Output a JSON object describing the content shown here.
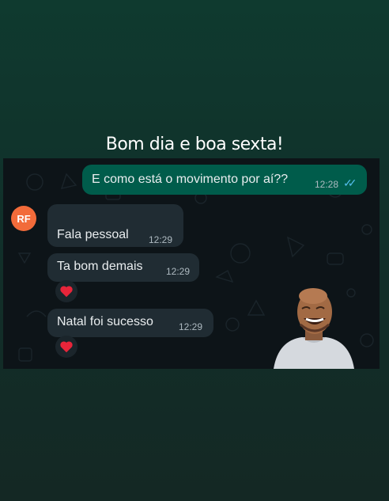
{
  "caption": "Bom dia e boa sexta!",
  "chat": {
    "avatar_initials": "RF",
    "messages": [
      {
        "direction": "outgoing",
        "text": "E como está o movimento por aí??",
        "time": "12:28",
        "status": "read"
      },
      {
        "direction": "incoming",
        "text": "Fala pessoal",
        "time": "12:29"
      },
      {
        "direction": "incoming",
        "text": "Ta bom demais",
        "time": "12:29",
        "reaction": "heart"
      },
      {
        "direction": "incoming",
        "text": "Natal foi sucesso",
        "time": "12:29",
        "reaction": "heart"
      }
    ],
    "sticker": "laughing-man-sticker"
  },
  "colors": {
    "outgoing_bubble": "#005c4b",
    "incoming_bubble": "#202c33",
    "avatar": "#f26b3a",
    "read_ticks": "#53bdeb",
    "reaction_heart": "#e8253a"
  }
}
